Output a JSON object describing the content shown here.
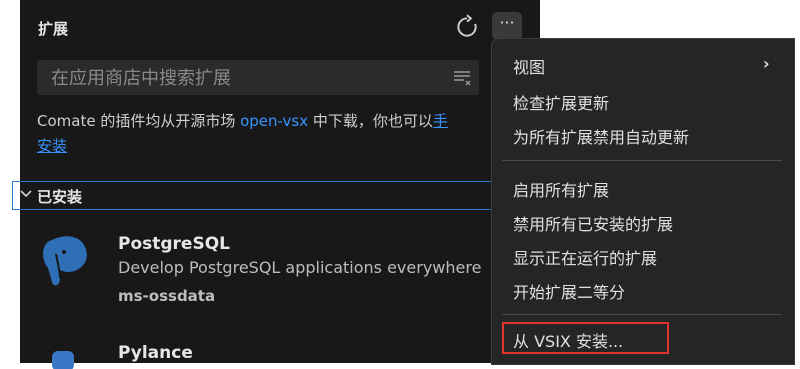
{
  "panel": {
    "title": "扩展",
    "search_placeholder": "在应用商店中搜索扩展",
    "notice": {
      "text_before": "Comate 的插件均从开源市场 ",
      "link": "open-vsx",
      "text_after": " 中下载，你也可以",
      "link2": "手",
      "link3": "安装"
    },
    "section_label": "已安装",
    "extensions": [
      {
        "name": "PostgreSQL",
        "description": "Develop PostgreSQL applications everywhere",
        "publisher": "ms-ossdata"
      },
      {
        "name": "Pylance"
      }
    ]
  },
  "menu": {
    "items": [
      {
        "label": "视图",
        "submenu": true
      },
      {
        "label": "检查扩展更新"
      },
      {
        "label": "为所有扩展禁用自动更新"
      },
      {
        "label": "启用所有扩展"
      },
      {
        "label": "禁用所有已安装的扩展"
      },
      {
        "label": "显示正在运行的扩展"
      },
      {
        "label": "开始扩展二等分"
      },
      {
        "label": "从 VSIX 安装..."
      }
    ]
  },
  "colors": {
    "link": "#3794ff",
    "highlight": "#e2332f",
    "accent": "#2c78c9"
  }
}
